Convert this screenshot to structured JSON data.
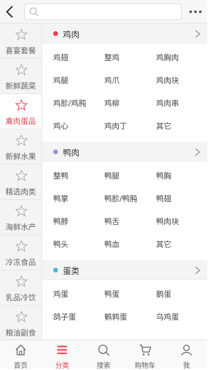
{
  "search": {
    "placeholder": ""
  },
  "sidebar": {
    "items": [
      {
        "label": "喜宴套餐",
        "active": false
      },
      {
        "label": "新鲜蔬菜",
        "active": false
      },
      {
        "label": "禽肉蛋品",
        "active": true
      },
      {
        "label": "新鲜水果",
        "active": false
      },
      {
        "label": "精选肉类",
        "active": false
      },
      {
        "label": "海鲜水产",
        "active": false
      },
      {
        "label": "冷冻食品",
        "active": false
      },
      {
        "label": "乳品冷饮",
        "active": false
      },
      {
        "label": "粮油副食",
        "active": false
      }
    ]
  },
  "sections": [
    {
      "title": "鸡肉",
      "dot_color": "#e8414e",
      "items": [
        "鸡翅",
        "整鸡",
        "鸡胸肉",
        "鸡腿",
        "鸡爪",
        "鸡肉块",
        "鸡胗/鸡肫",
        "鸡柳",
        "鸡肉串",
        "鸡心",
        "鸡肉丁",
        "其它"
      ]
    },
    {
      "title": "鸭肉",
      "dot_color": "#a48fd6",
      "items": [
        "整鸭",
        "鸭腿",
        "鸭胸",
        "鸭掌",
        "鸭胗/鸭肫",
        "鸭翅",
        "鸭脖",
        "鸭舌",
        "鸭肉块",
        "鸭头",
        "鸭血",
        "其它"
      ]
    },
    {
      "title": "蛋类",
      "dot_color": "#4fb8d9",
      "items": [
        "鸡蛋",
        "鸭蛋",
        "鹅蛋",
        "鸽子蛋",
        "鹌鹑蛋",
        "乌鸡蛋"
      ]
    }
  ],
  "tabbar": {
    "items": [
      {
        "label": "首页",
        "icon": "home-icon",
        "active": false
      },
      {
        "label": "分类",
        "icon": "category-icon",
        "active": true
      },
      {
        "label": "搜索",
        "icon": "search-icon",
        "active": false
      },
      {
        "label": "购物车",
        "icon": "cart-icon",
        "active": false
      },
      {
        "label": "我",
        "icon": "profile-icon",
        "active": false
      }
    ]
  },
  "colors": {
    "accent": "#e8414e",
    "text": "#333333",
    "muted": "#666666"
  }
}
